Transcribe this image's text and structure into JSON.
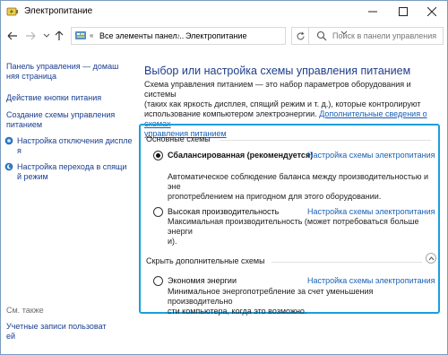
{
  "window": {
    "title": "Электропитание"
  },
  "address": {
    "overflow": "«",
    "crumbs": [
      "Все элементы панел...",
      "Электропитание"
    ],
    "search_placeholder": "Поиск в панели управления"
  },
  "sidebar": {
    "home_link": [
      "Панель управления — домаш",
      "няя страница"
    ],
    "links": [
      [
        "Действие кнопки питания"
      ],
      [
        "Создание схемы управления",
        "питанием"
      ],
      [
        "Настройка отключения диспле",
        "я"
      ],
      [
        "Настройка перехода в спящи",
        "й режим"
      ]
    ],
    "see_also_label": "См. также",
    "see_also_links": [
      [
        "Учетные записи пользоват",
        "ей"
      ]
    ]
  },
  "main": {
    "heading": "Выбор или настройка схемы управления питанием",
    "description_lines": [
      "Схема управления питанием — это набор параметров оборудования и системы",
      "(таких как яркость дисплея, спящий режим и т. д.), которые контролируют",
      "использование компьютером электроэнергии."
    ],
    "description_link_lines": [
      "Дополнительные сведения о схемах",
      "управления питанием"
    ],
    "primary_group_label": "Основные схемы",
    "hidden_group_label": "Скрыть дополнительные схемы",
    "plans": [
      {
        "name": "Сбалансированная (рекомендуется)",
        "selected": true,
        "link": "Настройка схемы электропитания",
        "desc": [
          "Автоматическое соблюдение баланса между производительностью и эне",
          "ргопотреблением на пригодном для этого оборудовании."
        ]
      },
      {
        "name": "Высокая производительность",
        "selected": false,
        "link": "Настройка схемы электропитания",
        "desc": [
          "Максимальная производительность (может потребоваться больше энерги",
          "и)."
        ]
      },
      {
        "name": "Экономия энергии",
        "selected": false,
        "link": "Настройка схемы электропитания",
        "desc": [
          "Минимальное энергопотребление за счет уменьшения производительно",
          "сти компьютера, когда это возможно."
        ]
      }
    ]
  },
  "colors": {
    "accent_highlight": "#1a9fdc",
    "link": "#1a5fb4",
    "heading": "#1f3d8a"
  }
}
